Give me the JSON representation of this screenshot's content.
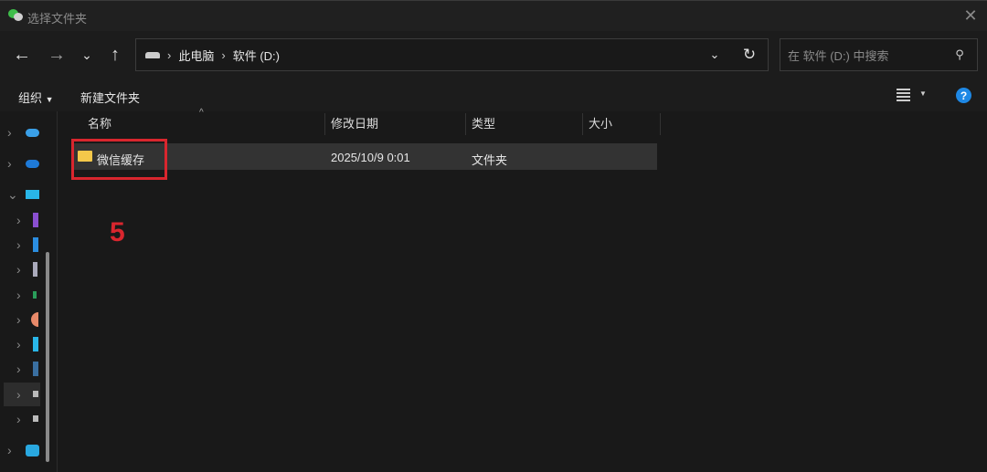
{
  "window": {
    "title": "选择文件夹"
  },
  "nav": {
    "breadcrumb": [
      "此电脑",
      "软件 (D:)"
    ],
    "search_placeholder": "在 软件 (D:) 中搜索"
  },
  "toolbar": {
    "organize": "组织",
    "new_folder": "新建文件夹"
  },
  "columns": [
    "名称",
    "修改日期",
    "类型",
    "大小"
  ],
  "files": [
    {
      "name": "微信缓存",
      "modified": "2025/10/9 0:01",
      "type": "文件夹",
      "size": ""
    }
  ],
  "annotation": {
    "label": "5",
    "color": "#d9262e"
  }
}
